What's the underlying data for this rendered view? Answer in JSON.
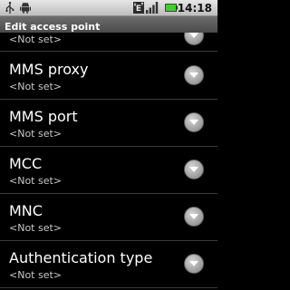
{
  "status_bar": {
    "time": "14:18",
    "icons": [
      "usb-icon",
      "android-debug-icon",
      "edge-network-icon",
      "signal-icon",
      "battery-icon"
    ],
    "battery_color": "#3fcf2a"
  },
  "title_bar": {
    "title": "Edit access point"
  },
  "list": {
    "partial_item": {
      "summary": "<Not set>"
    },
    "items": [
      {
        "title": "MMS proxy",
        "summary": "<Not set>"
      },
      {
        "title": "MMS port",
        "summary": "<Not set>"
      },
      {
        "title": "MCC",
        "summary": "<Not set>"
      },
      {
        "title": "MNC",
        "summary": "<Not set>"
      },
      {
        "title": "Authentication type",
        "summary": "<Not set>"
      }
    ],
    "chevron_icon": "chevron-down-icon"
  }
}
